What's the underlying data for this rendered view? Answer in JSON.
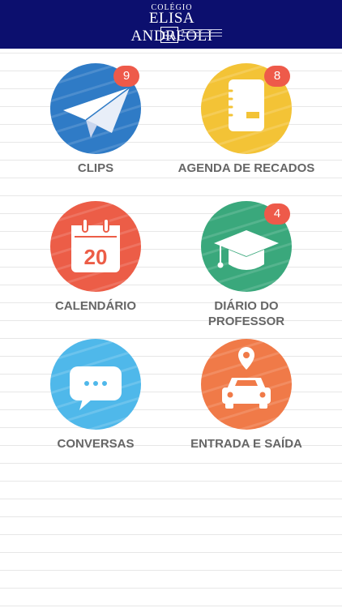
{
  "header": {
    "logo_line1": "COLÉGIO",
    "logo_line2": "ELISA ANDREOLI",
    "logo_mono": "EA"
  },
  "tiles": [
    {
      "label": "CLIPS",
      "badge": "9",
      "color": "#2f7bc6",
      "icon": "paper-plane-icon"
    },
    {
      "label": "AGENDA DE RECADOS",
      "badge": "8",
      "color": "#f3c336",
      "icon": "notebook-icon"
    },
    {
      "label": "CALENDÁRIO",
      "badge": "",
      "color": "#ec5d47",
      "icon": "calendar-icon"
    },
    {
      "label": "DIÁRIO DO PROFESSOR",
      "badge": "4",
      "color": "#3aa87c",
      "icon": "graduation-cap-icon"
    },
    {
      "label": "CONVERSAS",
      "badge": "",
      "color": "#4fb8ea",
      "icon": "chat-bubble-icon"
    },
    {
      "label": "ENTRADA E SAÍDA",
      "badge": "",
      "color": "#f07a48",
      "icon": "car-location-icon"
    }
  ],
  "calendar_day": "20",
  "colors": {
    "header_bg": "#0c0f6e",
    "badge_bg": "#ee5a4a",
    "label_text": "#666666"
  }
}
